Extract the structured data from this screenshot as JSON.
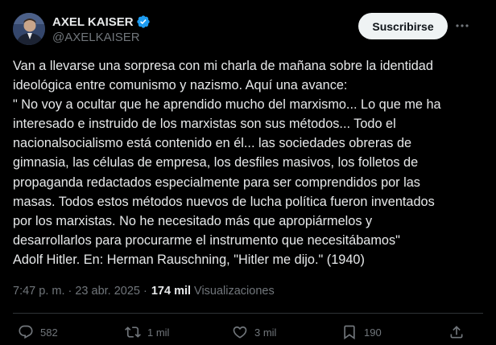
{
  "author": {
    "name": "AXEL KAISER",
    "handle": "@AXELKAISER"
  },
  "header": {
    "subscribe_label": "Suscribirse"
  },
  "post": {
    "lines": [
      "Van a llevarse una sorpresa con mi charla de mañana sobre la identidad",
      "ideológica entre comunismo y nazismo. Aquí una avance:",
      "\" No voy a ocultar que he aprendido mucho del marxismo... Lo que me ha",
      "interesado e instruido de los marxistas son sus métodos... Todo el",
      "nacionalsocialismo está contenido en él... las sociedades obreras de",
      "gimnasia, las células de empresa, los desfiles masivos, los folletos de",
      "propaganda redactados especialmente para ser comprendidos por las",
      "masas. Todos estos métodos nuevos de lucha política fueron inventados",
      "por los marxistas. No he necesitado más que apropiármelos y",
      "desarrollarlos para procurarme el instrumento que necesitábamos\"",
      "Adolf Hitler. En: Herman Rauschning, \"Hitler me dijo.\" (1940)"
    ]
  },
  "meta": {
    "timestamp": "7:47 p. m. · 23 abr. 2025 ·",
    "views_count": "174 mil",
    "views_label": "Visualizaciones"
  },
  "actions": {
    "replies": "582",
    "reposts": "1 mil",
    "likes": "3 mil",
    "bookmarks": "190"
  },
  "colors": {
    "background": "#000000",
    "text": "#e7e9ea",
    "muted": "#71767b",
    "verified": "#1d9bf0",
    "button_bg": "#eff3f4"
  },
  "icons": [
    "verified-badge-icon",
    "more-options-icon",
    "reply-icon",
    "repost-icon",
    "like-icon",
    "bookmark-icon",
    "share-icon"
  ]
}
